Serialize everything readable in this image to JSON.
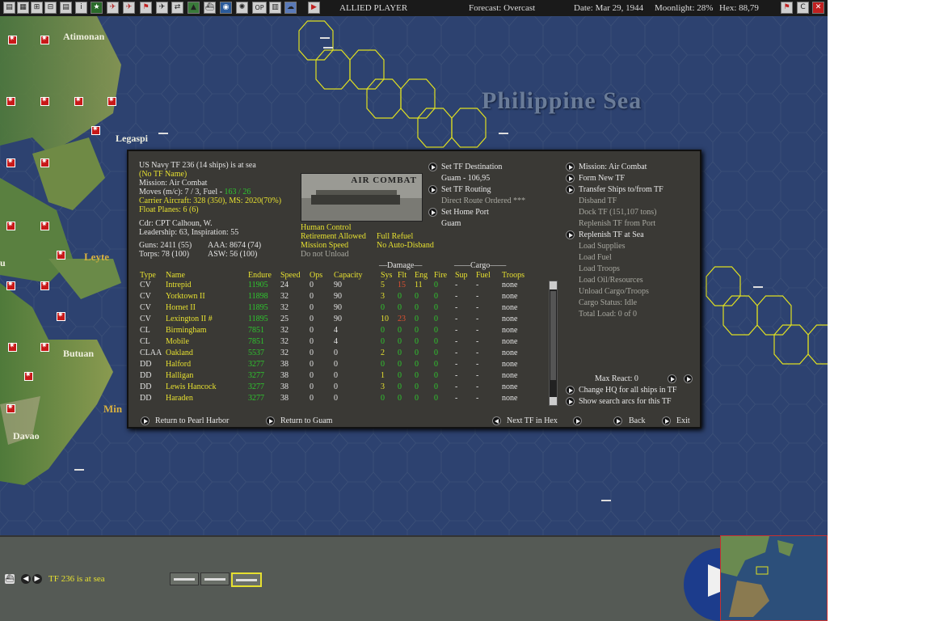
{
  "toolbar": {
    "player": "ALLIED PLAYER",
    "forecast": "Forecast: Overcast",
    "date": "Date: Mar 29, 1944",
    "moonlight": "Moonlight: 28%",
    "hex": "Hex: 88,79",
    "buttons": [
      "menu",
      "report",
      "ships",
      "aircraft",
      "info",
      "lcu",
      "air",
      "naval",
      "flag",
      "ops",
      "terrain",
      "load",
      "rotate",
      "network",
      "OP",
      "stack",
      "globe"
    ]
  },
  "map": {
    "places": [
      "Atimonan",
      "Legaspi",
      "Leyte",
      "Butuan",
      "Davao",
      "Min",
      "u"
    ],
    "sea": "Philippine Sea"
  },
  "dialog": {
    "tf_status": "US Navy TF 236 (14 ships) is at sea",
    "tf_name": "(No TF Name)",
    "mission": "Mission: Air Combat",
    "moves_prefix": "Moves (m/c): 7 / 3, Fuel - ",
    "fuel": "163 / 26",
    "carrier_aircraft": "Carrier Aircraft: 328 (350), MS: 2020(70%)",
    "float_planes": "Float Planes: 6 (6)",
    "commander": "Cdr: CPT Calhoun, W.",
    "leadership": "Leadership: 63, Inspiration: 55",
    "guns": "Guns: 2411 (55)",
    "aaa": "AAA: 8674 (74)",
    "torps": "Torps: 78 (100)",
    "asw": "ASW: 56 (100)",
    "photo_caption": "AIR COMBAT",
    "flags": {
      "human_control": "Human Control",
      "retirement": "Retirement Allowed",
      "full_refuel": "Full Refuel",
      "mission_speed": "Mission Speed",
      "no_auto_disband": "No Auto-Disband",
      "do_not_unload": "Do not Unload"
    },
    "routing": {
      "set_destination": "Set TF Destination",
      "destination": "Guam - 106,95",
      "set_routing": "Set TF Routing",
      "route": "Direct Route Ordered ***",
      "set_home": "Set Home Port",
      "home": "Guam"
    },
    "actions": {
      "mission": "Mission: Air Combat",
      "form_new": "Form New TF",
      "transfer": "Transfer Ships to/from TF",
      "disband": "Disband TF",
      "dock": "Dock TF (151,107 tons)",
      "replenish_port": "Replenish TF from Port",
      "replenish_sea": "Replenish TF at Sea",
      "load_supplies": "Load Supplies",
      "load_fuel": "Load Fuel",
      "load_troops": "Load Troops",
      "load_oil": "Load Oil/Resources",
      "unload": "Unload Cargo/Troops",
      "cargo_status": "Cargo Status: Idle",
      "total_load": "Total Load: 0 of 0",
      "max_react": "Max React: 0",
      "change_hq": "Change HQ for all ships in TF",
      "search_arcs": "Show search arcs for this TF"
    },
    "table": {
      "group_damage": "Damage",
      "group_cargo": "Cargo",
      "headers": [
        "Type",
        "Name",
        "Endure",
        "Speed",
        "Ops",
        "Capacity",
        "Sys",
        "Flt",
        "Eng",
        "Fire",
        "Sup",
        "Fuel",
        "Troops"
      ],
      "rows": [
        [
          "CV",
          "Intrepid",
          "11905",
          "24",
          "0",
          "90",
          "5",
          "15",
          "11",
          "0",
          "-",
          "-",
          "none"
        ],
        [
          "CV",
          "Yorktown II",
          "11898",
          "32",
          "0",
          "90",
          "3",
          "0",
          "0",
          "0",
          "-",
          "-",
          "none"
        ],
        [
          "CV",
          "Hornet II",
          "11895",
          "32",
          "0",
          "90",
          "0",
          "0",
          "0",
          "0",
          "-",
          "-",
          "none"
        ],
        [
          "CV",
          "Lexington II #",
          "11895",
          "25",
          "0",
          "90",
          "10",
          "23",
          "0",
          "0",
          "-",
          "-",
          "none"
        ],
        [
          "CL",
          "Birmingham",
          "7851",
          "32",
          "0",
          "4",
          "0",
          "0",
          "0",
          "0",
          "-",
          "-",
          "none"
        ],
        [
          "CL",
          "Mobile",
          "7851",
          "32",
          "0",
          "4",
          "0",
          "0",
          "0",
          "0",
          "-",
          "-",
          "none"
        ],
        [
          "CLAA",
          "Oakland",
          "5537",
          "32",
          "0",
          "0",
          "2",
          "0",
          "0",
          "0",
          "-",
          "-",
          "none"
        ],
        [
          "DD",
          "Halford",
          "3277",
          "38",
          "0",
          "0",
          "0",
          "0",
          "0",
          "0",
          "-",
          "-",
          "none"
        ],
        [
          "DD",
          "Halligan",
          "3277",
          "38",
          "0",
          "0",
          "1",
          "0",
          "0",
          "0",
          "-",
          "-",
          "none"
        ],
        [
          "DD",
          "Lewis Hancock",
          "3277",
          "38",
          "0",
          "0",
          "3",
          "0",
          "0",
          "0",
          "-",
          "-",
          "none"
        ],
        [
          "DD",
          "Haraden",
          "3277",
          "38",
          "0",
          "0",
          "0",
          "0",
          "0",
          "0",
          "-",
          "-",
          "none"
        ]
      ]
    },
    "footer": {
      "return_pearl": "Return to Pearl Harbor",
      "return_guam": "Return to Guam",
      "next_tf": "Next TF in Hex",
      "back": "Back",
      "exit": "Exit"
    }
  },
  "bottom": {
    "status": "TF 236 is at sea"
  }
}
